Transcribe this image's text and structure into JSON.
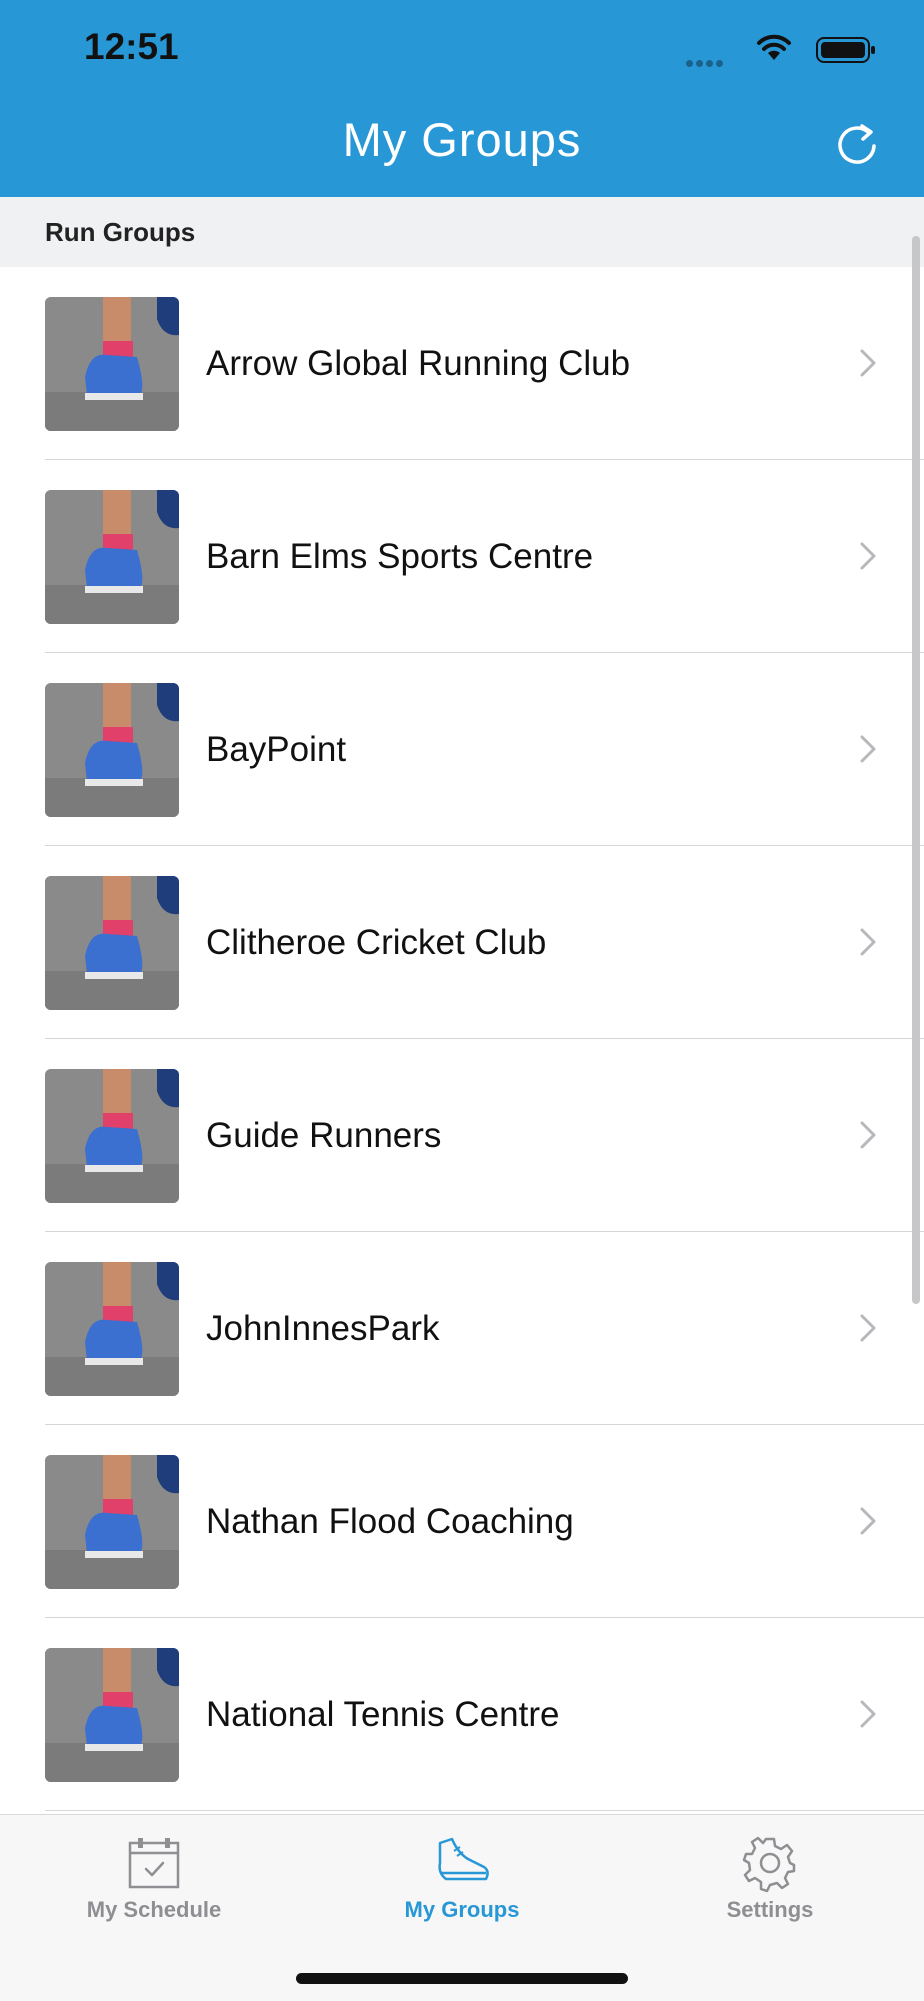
{
  "status_bar": {
    "time": "12:51"
  },
  "header": {
    "title": "My Groups",
    "refresh_icon": "refresh-icon"
  },
  "section": {
    "title": "Run Groups"
  },
  "groups": [
    {
      "name": "Arrow Global Running Club"
    },
    {
      "name": "Barn Elms Sports Centre"
    },
    {
      "name": "BayPoint"
    },
    {
      "name": "Clitheroe Cricket Club"
    },
    {
      "name": "Guide Runners"
    },
    {
      "name": "JohnInnesPark"
    },
    {
      "name": "Nathan Flood Coaching"
    },
    {
      "name": "National Tennis Centre"
    }
  ],
  "tabbar": {
    "tabs": [
      {
        "label": "My Schedule",
        "icon": "calendar-check-icon",
        "active": false
      },
      {
        "label": "My Groups",
        "icon": "running-shoe-icon",
        "active": true
      },
      {
        "label": "Settings",
        "icon": "gear-icon",
        "active": false
      }
    ]
  },
  "colors": {
    "accent": "#2897d6",
    "tab_active": "#2897d6",
    "tab_inactive": "#8e8e93"
  }
}
